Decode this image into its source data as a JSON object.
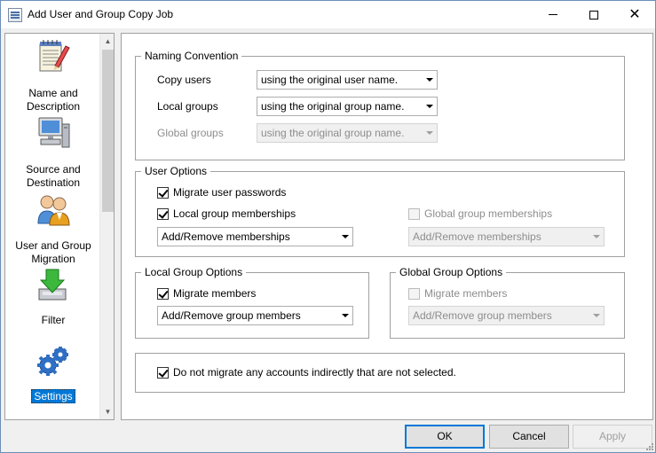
{
  "window": {
    "title": "Add User and Group Copy Job",
    "icon": "app-window-icon",
    "controls": {
      "minimize": "minimize-icon",
      "maximize": "maximize-icon",
      "close": "✕"
    }
  },
  "nav": {
    "items": [
      {
        "label_line1": "Name and",
        "label_line2": "Description",
        "icon": "notepad-pencil-icon"
      },
      {
        "label_line1": "Source and",
        "label_line2": "Destination",
        "icon": "computer-icon"
      },
      {
        "label_line1": "User and Group",
        "label_line2": "Migration",
        "icon": "users-icon"
      },
      {
        "label_line1": "Filter",
        "label_line2": "",
        "icon": "filter-download-icon"
      },
      {
        "label_line1": "Settings",
        "label_line2": "",
        "icon": "gears-icon",
        "selected": true
      }
    ],
    "scroll_up": "▲",
    "scroll_down": "▼"
  },
  "naming": {
    "legend": "Naming Convention",
    "copy_users_label": "Copy users",
    "copy_users_value": "using the original user name.",
    "local_groups_label": "Local groups",
    "local_groups_value": "using the original group name.",
    "global_groups_label": "Global groups",
    "global_groups_value": "using the original group name."
  },
  "user_options": {
    "legend": "User Options",
    "migrate_passwords_label": "Migrate user passwords",
    "migrate_passwords_checked": true,
    "local_memberships_label": "Local group memberships",
    "local_memberships_checked": true,
    "global_memberships_label": "Global group memberships",
    "global_memberships_checked": false,
    "local_memberships_mode": "Add/Remove memberships",
    "global_memberships_mode": "Add/Remove memberships"
  },
  "local_group_options": {
    "legend": "Local Group Options",
    "migrate_members_label": "Migrate members",
    "migrate_members_checked": true,
    "members_mode": "Add/Remove group members"
  },
  "global_group_options": {
    "legend": "Global Group Options",
    "migrate_members_label": "Migrate members",
    "migrate_members_checked": false,
    "members_mode": "Add/Remove group members"
  },
  "indirect": {
    "label": "Do not migrate any accounts indirectly that are not selected.",
    "checked": true
  },
  "buttons": {
    "ok": "OK",
    "cancel": "Cancel",
    "apply": "Apply"
  }
}
